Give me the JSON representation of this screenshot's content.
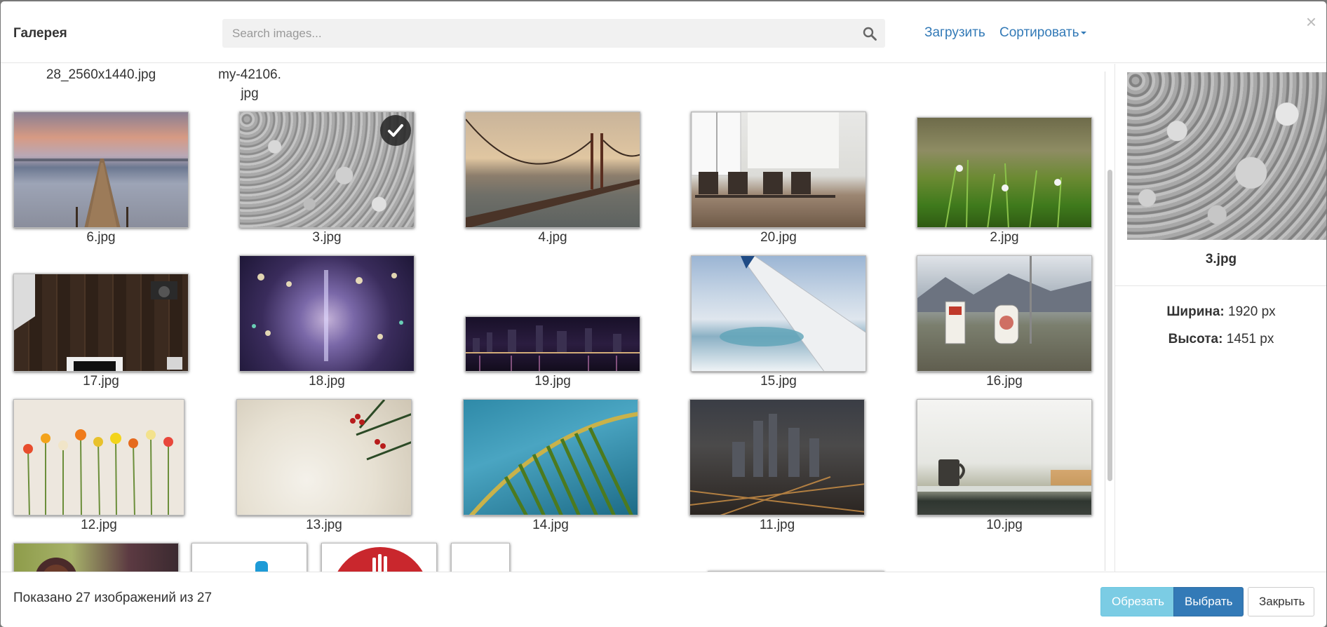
{
  "header": {
    "title": "Галерея",
    "search_placeholder": "Search images...",
    "upload_label": "Загрузить",
    "sort_label": "Сортировать"
  },
  "grid": {
    "partial_top_captions": [
      "28_2560x1440.jpg",
      "my-42106.",
      "jpg"
    ],
    "rows": [
      [
        "6.jpg",
        "3.jpg",
        "4.jpg",
        "20.jpg",
        "2.jpg"
      ],
      [
        "17.jpg",
        "18.jpg",
        "19.jpg",
        "15.jpg",
        "16.jpg"
      ],
      [
        "12.jpg",
        "13.jpg",
        "14.jpg",
        "11.jpg",
        "10.jpg"
      ]
    ],
    "selected_item": "3.jpg"
  },
  "sidebar": {
    "file_name": "3.jpg",
    "width_label": "Ширина:",
    "width_value": "1920 px",
    "height_label": "Высота:",
    "height_value": "1451 px"
  },
  "footer": {
    "count_text": "Показано 27 изображений из 27",
    "crop_label": "Обрезать",
    "select_label": "Выбрать",
    "close_label": "Закрыть"
  },
  "colors": {
    "link": "#337ab7",
    "crop_button": "#5bc0de",
    "select_button": "#337ab7"
  }
}
